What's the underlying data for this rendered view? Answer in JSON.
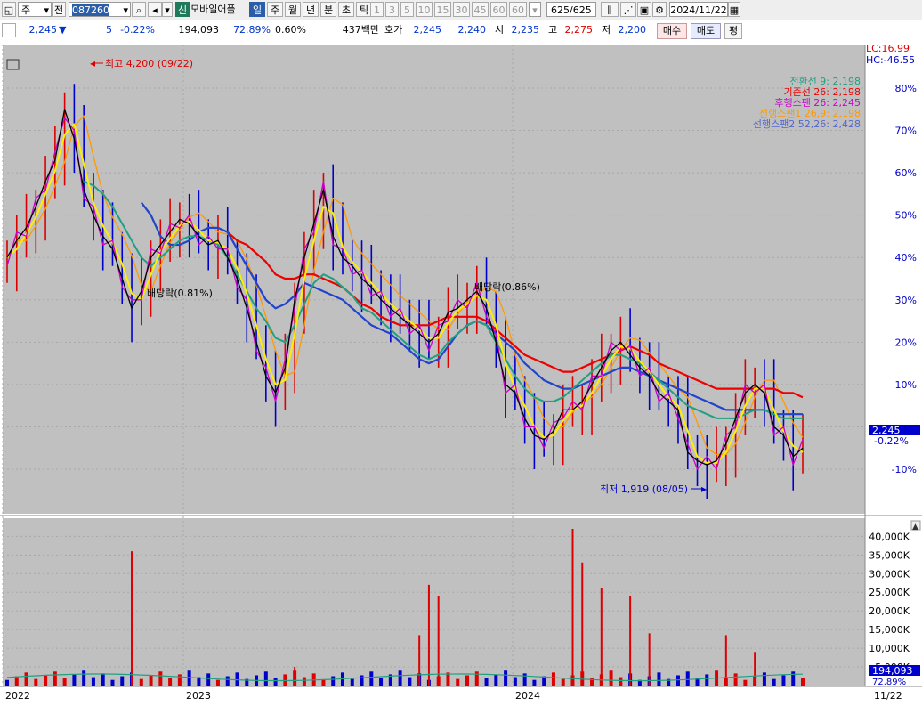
{
  "toolbar": {
    "market": "주",
    "prev": "전",
    "code": "087260",
    "badge": "신",
    "name": "모바일어플",
    "periods": [
      {
        "label": "일",
        "selected": true
      },
      {
        "label": "주",
        "selected": false
      },
      {
        "label": "월",
        "selected": false
      },
      {
        "label": "년",
        "selected": false
      },
      {
        "label": "분",
        "selected": false
      },
      {
        "label": "초",
        "selected": false
      },
      {
        "label": "틱",
        "selected": false
      }
    ],
    "intervals": [
      "1",
      "3",
      "5",
      "10",
      "15",
      "30",
      "45",
      "60"
    ],
    "interval_value": "60",
    "count": "625",
    "count_total": "/625",
    "date": "2024/11/22"
  },
  "quote": {
    "price": "2,245",
    "direction": "▼",
    "change": "5",
    "change_pct": "-0.22%",
    "volume": "194,093",
    "vol_ratio": "72.89%",
    "turnover": "0.60%",
    "amount": "437백만",
    "bid_label": "호가",
    "bid": "2,245",
    "ask": "2,240",
    "open_label": "시",
    "open": "2,235",
    "high_label": "고",
    "high": "2,275",
    "low_label": "저",
    "low": "2,200",
    "buy_button": "매수",
    "sell_button": "매도",
    "eval_button": "평"
  },
  "colors": {
    "plot_bg": "#c0c0c0",
    "up": "#dd0000",
    "down": "#0000cc",
    "conversion": "#20a080",
    "base": "#ee0000",
    "lagging": "#cc00cc",
    "span1": "#ff9900",
    "span2": "#2244cc",
    "yellow": "#ffee00",
    "black": "#000000"
  },
  "chart_data": {
    "type": "line",
    "price_panel": {
      "yaxis_percent_ticks": [
        "80%",
        "70%",
        "60%",
        "50%",
        "40%",
        "30%",
        "20%",
        "10%",
        "-10%"
      ],
      "lc": "LC:16.99",
      "hc": "HC:-46.55",
      "current_price_label": "2,245",
      "current_change_label": "-0.22%",
      "annotations": [
        {
          "text": "최고 4,200 (09/22)"
        },
        {
          "text": "최저 1,919 (08/05)"
        },
        {
          "text": "배당락(0.81%)"
        },
        {
          "text": "배당락(0.86%)"
        }
      ],
      "legend": [
        {
          "name": "전환선 9: 2,198",
          "color": "#20a080"
        },
        {
          "name": "기준선 26: 2,198",
          "color": "#ee0000"
        },
        {
          "name": "후행스팬 26: 2,245",
          "color": "#cc00cc"
        },
        {
          "name": "선행스팬1 26,9: 2,198",
          "color": "#ff9900"
        },
        {
          "name": "선행스팬2 52,26: 2,428",
          "color": "#5566cc"
        }
      ],
      "series_pct": {
        "close": [
          40,
          44,
          47,
          52,
          58,
          63,
          75,
          68,
          56,
          50,
          45,
          42,
          35,
          28,
          32,
          40,
          43,
          46,
          49,
          48,
          45,
          43,
          44,
          40,
          35,
          28,
          20,
          12,
          8,
          14,
          30,
          40,
          48,
          56,
          45,
          40,
          38,
          35,
          33,
          30,
          28,
          26,
          24,
          22,
          20,
          22,
          27,
          28,
          30,
          32,
          28,
          20,
          10,
          8,
          2,
          -2,
          -3,
          -1,
          4,
          4,
          6,
          10,
          14,
          18,
          20,
          17,
          14,
          12,
          8,
          6,
          4,
          -6,
          -8,
          -9,
          -8,
          -4,
          2,
          8,
          10,
          8,
          0,
          -2,
          -7,
          -5
        ],
        "ma_blue": [
          null,
          null,
          null,
          null,
          null,
          null,
          null,
          null,
          null,
          null,
          null,
          null,
          null,
          null,
          53,
          50,
          45,
          43,
          43,
          44,
          46,
          47,
          47,
          46,
          42,
          38,
          34,
          30,
          28,
          29,
          31,
          34,
          33,
          32,
          31,
          30,
          28,
          26,
          24,
          23,
          22,
          20,
          18,
          16,
          15,
          16,
          19,
          22,
          24,
          25,
          24,
          22,
          20,
          18,
          15,
          13,
          11,
          10,
          9,
          9,
          10,
          11,
          12,
          13,
          14,
          14,
          13,
          12,
          11,
          10,
          9,
          8,
          7,
          6,
          5,
          4,
          4,
          4,
          4,
          4,
          3,
          3,
          3,
          3
        ],
        "ma_red": [
          null,
          null,
          null,
          null,
          null,
          null,
          null,
          null,
          null,
          null,
          null,
          null,
          null,
          null,
          null,
          null,
          null,
          null,
          null,
          null,
          null,
          null,
          null,
          46,
          44,
          43,
          41,
          39,
          36,
          35,
          35,
          36,
          36,
          35,
          34,
          33,
          31,
          29,
          28,
          26,
          25,
          24,
          24,
          24,
          24,
          25,
          26,
          26,
          26,
          26,
          25,
          23,
          21,
          19,
          17,
          16,
          15,
          14,
          13,
          13,
          14,
          15,
          16,
          17,
          18,
          19,
          18,
          17,
          15,
          14,
          13,
          12,
          11,
          10,
          9,
          9,
          9,
          9,
          9,
          9,
          9,
          8,
          8,
          7
        ],
        "ma_green": [
          null,
          null,
          null,
          null,
          null,
          null,
          null,
          null,
          58,
          57,
          55,
          52,
          48,
          44,
          40,
          38,
          40,
          42,
          44,
          45,
          45,
          44,
          43,
          40,
          36,
          32,
          28,
          25,
          21,
          20,
          24,
          29,
          34,
          36,
          35,
          33,
          31,
          28,
          27,
          25,
          23,
          21,
          19,
          17,
          16,
          17,
          20,
          22,
          24,
          25,
          24,
          20,
          16,
          12,
          9,
          7,
          6,
          6,
          7,
          9,
          11,
          13,
          15,
          17,
          17,
          16,
          15,
          13,
          11,
          9,
          7,
          5,
          4,
          3,
          2,
          2,
          2,
          3,
          4,
          4,
          3,
          2,
          2,
          2
        ]
      }
    },
    "volume_panel": {
      "yaxis_ticks": [
        "40,000K",
        "35,000K",
        "30,000K",
        "25,000K",
        "20,000K",
        "15,000K",
        "10,000K",
        "5,000K"
      ],
      "ymax": 42000,
      "current_volume_label": "194,093",
      "current_ratio_label": "72.89%",
      "spikes": [
        {
          "i": 13,
          "v": 36000
        },
        {
          "i": 30,
          "v": 5000
        },
        {
          "i": 43,
          "v": 13500
        },
        {
          "i": 44,
          "v": 27000
        },
        {
          "i": 45,
          "v": 24000
        },
        {
          "i": 59,
          "v": 42000
        },
        {
          "i": 60,
          "v": 33000
        },
        {
          "i": 62,
          "v": 26000
        },
        {
          "i": 65,
          "v": 24000
        },
        {
          "i": 67,
          "v": 14000
        },
        {
          "i": 75,
          "v": 13500
        },
        {
          "i": 78,
          "v": 9000
        }
      ]
    },
    "x_labels": [
      "2022",
      "2023",
      "2024"
    ],
    "x_last_label": "11/22"
  }
}
